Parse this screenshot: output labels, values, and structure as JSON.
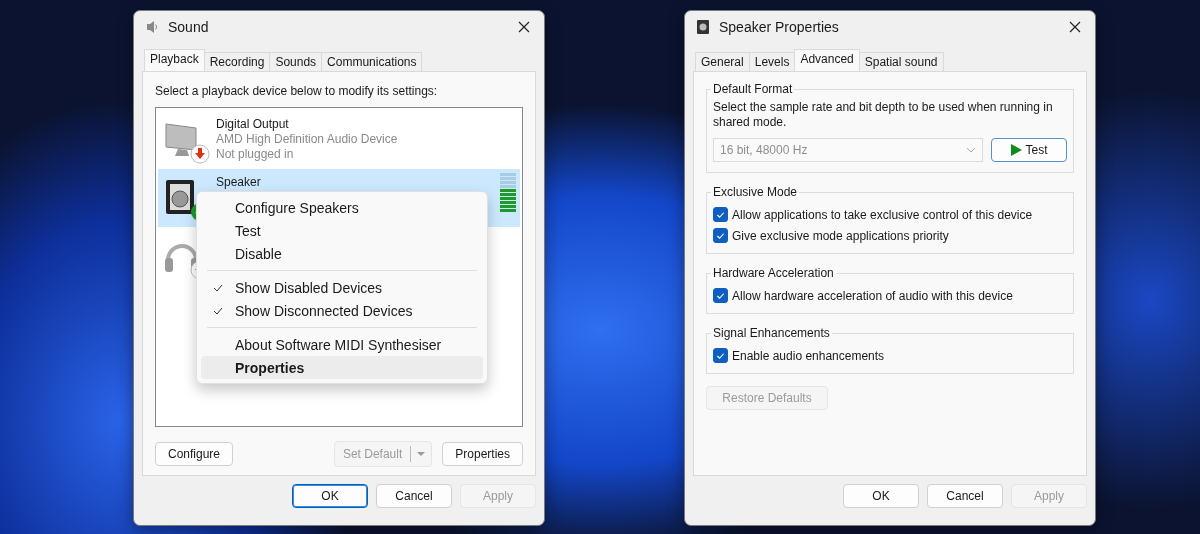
{
  "sound_window": {
    "title": "Sound",
    "tabs": [
      {
        "label": "Playback",
        "selected": true
      },
      {
        "label": "Recording",
        "selected": false
      },
      {
        "label": "Sounds",
        "selected": false
      },
      {
        "label": "Communications",
        "selected": false
      }
    ],
    "instruction": "Select a playback device below to modify its settings:",
    "devices": [
      {
        "kind": "monitor",
        "plugged_in": false,
        "selected": false,
        "name": "Digital Output",
        "description": "AMD High Definition Audio Device",
        "status": "Not plugged in"
      },
      {
        "kind": "speaker",
        "plugged_in": true,
        "is_default": true,
        "selected": true,
        "name": "Speaker",
        "level": 0.6
      },
      {
        "kind": "headphones",
        "plugged_in": false,
        "selected": false
      }
    ],
    "configure_button": {
      "label": "Configure",
      "disabled": false
    },
    "set_default_button": {
      "label": "Set Default",
      "disabled": true
    },
    "properties_button": {
      "label": "Properties",
      "disabled": false
    },
    "dialog_buttons": [
      {
        "label": "OK",
        "default": true,
        "disabled": false
      },
      {
        "label": "Cancel",
        "default": false,
        "disabled": false
      },
      {
        "label": "Apply",
        "default": false,
        "disabled": true
      }
    ]
  },
  "context_menu": {
    "items": [
      {
        "kind": "item",
        "label": "Configure Speakers",
        "checked": false,
        "bold": false,
        "selected": false
      },
      {
        "kind": "item",
        "label": "Test",
        "checked": false,
        "bold": false,
        "selected": false
      },
      {
        "kind": "item",
        "label": "Disable",
        "checked": false,
        "bold": false,
        "selected": false
      },
      {
        "kind": "separator"
      },
      {
        "kind": "item",
        "label": "Show Disabled Devices",
        "checked": true,
        "bold": false,
        "selected": false
      },
      {
        "kind": "item",
        "label": "Show Disconnected Devices",
        "checked": true,
        "bold": false,
        "selected": false
      },
      {
        "kind": "separator"
      },
      {
        "kind": "item",
        "label": "About Software MIDI Synthesiser",
        "checked": false,
        "bold": false,
        "selected": false
      },
      {
        "kind": "item",
        "label": "Properties",
        "checked": false,
        "bold": true,
        "selected": true
      }
    ]
  },
  "properties_window": {
    "title": "Speaker Properties",
    "tabs": [
      {
        "label": "General",
        "selected": false
      },
      {
        "label": "Levels",
        "selected": false
      },
      {
        "label": "Advanced",
        "selected": true
      },
      {
        "label": "Spatial sound",
        "selected": false
      }
    ],
    "groups": [
      {
        "kind": "format",
        "legend": "Default Format",
        "description": "Select the sample rate and bit depth to be used when running in shared mode.",
        "format_value": "16 bit, 48000 Hz",
        "format_disabled": true,
        "test_button": "Test"
      },
      {
        "kind": "options",
        "legend": "Exclusive Mode",
        "options": [
          {
            "label": "Allow applications to take exclusive control of this device",
            "checked": true
          },
          {
            "label": "Give exclusive mode applications priority",
            "checked": true
          }
        ]
      },
      {
        "kind": "options",
        "legend": "Hardware Acceleration",
        "options": [
          {
            "label": "Allow hardware acceleration of audio with this device",
            "checked": true
          }
        ]
      },
      {
        "kind": "options",
        "legend": "Signal Enhancements",
        "options": [
          {
            "label": "Enable audio enhancements",
            "checked": true
          }
        ]
      }
    ],
    "restore_button": {
      "label": "Restore Defaults",
      "disabled": true
    },
    "dialog_buttons": [
      {
        "label": "OK",
        "default": false,
        "disabled": false
      },
      {
        "label": "Cancel",
        "default": false,
        "disabled": false
      },
      {
        "label": "Apply",
        "default": false,
        "disabled": true
      }
    ]
  }
}
